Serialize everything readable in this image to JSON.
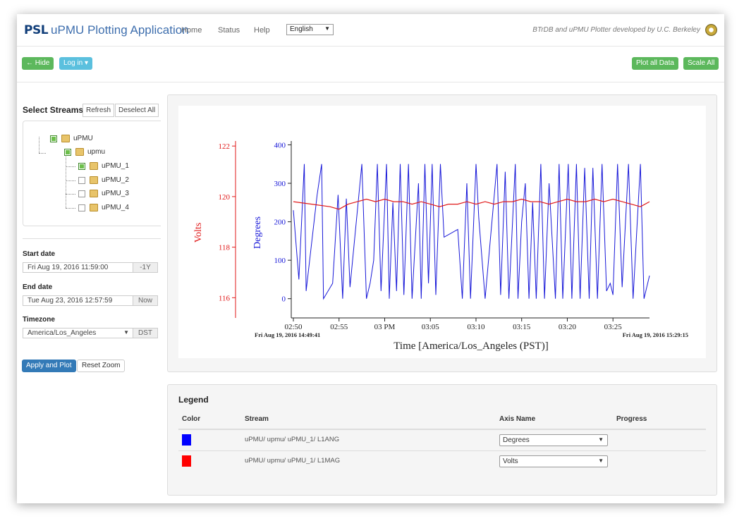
{
  "app": {
    "brand_abbrev": "PSL",
    "brand_title": "uPMU Plotting Application",
    "nav": [
      "Home",
      "Status",
      "Help"
    ],
    "language": "English",
    "credit": "BTrDB and uPMU Plotter developed by U.C. Berkeley"
  },
  "toolbar": {
    "hide_label": "← Hide",
    "login_label": "Log in ▾",
    "plot_all_label": "Plot all Data",
    "scale_all_label": "Scale All"
  },
  "sidebar": {
    "title": "Select Streams",
    "refresh_label": "Refresh",
    "deselect_label": "Deselect All",
    "tree": [
      {
        "label": "uPMU",
        "checked": true
      },
      {
        "label": "upmu",
        "checked": true
      },
      {
        "label": "uPMU_1",
        "checked": true
      },
      {
        "label": "uPMU_2",
        "checked": false
      },
      {
        "label": "uPMU_3",
        "checked": false
      },
      {
        "label": "uPMU_4",
        "checked": false
      }
    ],
    "start_label": "Start date",
    "start_value": "Fri Aug 19, 2016 11:59:00",
    "start_addon": "-1Y",
    "end_label": "End date",
    "end_value": "Tue Aug 23, 2016 12:57:59",
    "end_addon": "Now",
    "tz_label": "Timezone",
    "tz_value": "America/Los_Angeles",
    "tz_addon": "DST",
    "apply_label": "Apply and Plot",
    "reset_label": "Reset Zoom"
  },
  "chart_data": {
    "type": "line",
    "xlabel": "Time [America/Los_Angeles (PST)]",
    "start_stamp": "Fri Aug 19, 2016 14:49:41",
    "end_stamp": "Fri Aug 19, 2016 15:29:15",
    "x_ticks": [
      "02:50",
      "02:55",
      "03 PM",
      "03:05",
      "03:10",
      "03:15",
      "03:20",
      "03:25"
    ],
    "x_range_min": [
      50,
      89
    ],
    "y_axes": [
      {
        "name": "Volts",
        "color": "#e01818",
        "ylim": [
          115.2,
          122.2
        ],
        "ticks": [
          116,
          118,
          120,
          122
        ]
      },
      {
        "name": "Degrees",
        "color": "#1818d8",
        "ylim": [
          -50,
          410
        ],
        "ticks": [
          0,
          100,
          200,
          300,
          400
        ]
      }
    ],
    "series": [
      {
        "name": "Degrees",
        "axis": "Degrees",
        "color": "#1818d8",
        "points": [
          [
            50,
            230
          ],
          [
            50.6,
            50
          ],
          [
            51.2,
            350
          ],
          [
            51.4,
            20
          ],
          [
            52.6,
            270
          ],
          [
            53.1,
            350
          ],
          [
            53.3,
            0
          ],
          [
            54.3,
            40
          ],
          [
            54.9,
            270
          ],
          [
            55.4,
            0
          ],
          [
            55.8,
            260
          ],
          [
            56.2,
            30
          ],
          [
            57.5,
            350
          ],
          [
            58,
            0
          ],
          [
            58.4,
            40
          ],
          [
            58.8,
            100
          ],
          [
            59.2,
            350
          ],
          [
            59.6,
            20
          ],
          [
            60.2,
            350
          ],
          [
            60.5,
            0
          ],
          [
            60.9,
            250
          ],
          [
            61.3,
            20
          ],
          [
            61.7,
            350
          ],
          [
            62.1,
            10
          ],
          [
            62.6,
            350
          ],
          [
            63,
            0
          ],
          [
            63.7,
            300
          ],
          [
            64,
            0
          ],
          [
            64.4,
            350
          ],
          [
            64.8,
            40
          ],
          [
            65.2,
            350
          ],
          [
            65.6,
            10
          ],
          [
            66.1,
            350
          ],
          [
            66.5,
            160
          ],
          [
            68,
            180
          ],
          [
            68.5,
            0
          ],
          [
            69,
            300
          ],
          [
            69.4,
            0
          ],
          [
            70,
            350
          ],
          [
            70.3,
            210
          ],
          [
            71,
            0
          ],
          [
            72.3,
            350
          ],
          [
            72.7,
            10
          ],
          [
            73.2,
            330
          ],
          [
            73.6,
            0
          ],
          [
            74.3,
            350
          ],
          [
            74.6,
            0
          ],
          [
            75,
            200
          ],
          [
            75.4,
            300
          ],
          [
            75.8,
            0
          ],
          [
            76.2,
            250
          ],
          [
            76.6,
            0
          ],
          [
            77.1,
            350
          ],
          [
            77.5,
            0
          ],
          [
            78,
            300
          ],
          [
            78.7,
            0
          ],
          [
            79.1,
            350
          ],
          [
            79.5,
            0
          ],
          [
            80.1,
            350
          ],
          [
            80.5,
            0
          ],
          [
            81,
            350
          ],
          [
            81.4,
            0
          ],
          [
            81.9,
            340
          ],
          [
            82.4,
            0
          ],
          [
            82.8,
            340
          ],
          [
            83.3,
            0
          ],
          [
            83.8,
            350
          ],
          [
            84.3,
            20
          ],
          [
            84.7,
            40
          ],
          [
            85,
            10
          ],
          [
            85.5,
            350
          ],
          [
            86,
            30
          ],
          [
            86.7,
            350
          ],
          [
            87.2,
            0
          ],
          [
            88,
            350
          ],
          [
            88.4,
            0
          ],
          [
            89,
            60
          ]
        ]
      },
      {
        "name": "Volts",
        "axis": "Volts",
        "color": "#e01818",
        "points": [
          [
            50,
            119.8
          ],
          [
            52,
            119.7
          ],
          [
            54,
            119.6
          ],
          [
            55,
            119.5
          ],
          [
            56,
            119.7
          ],
          [
            57,
            119.8
          ],
          [
            58,
            119.9
          ],
          [
            59,
            119.8
          ],
          [
            60,
            119.9
          ],
          [
            61,
            119.8
          ],
          [
            62,
            119.8
          ],
          [
            63,
            119.7
          ],
          [
            64,
            119.8
          ],
          [
            65,
            119.7
          ],
          [
            66,
            119.6
          ],
          [
            67,
            119.7
          ],
          [
            68,
            119.7
          ],
          [
            69,
            119.8
          ],
          [
            70,
            119.7
          ],
          [
            71,
            119.8
          ],
          [
            72,
            119.7
          ],
          [
            73,
            119.8
          ],
          [
            74,
            119.8
          ],
          [
            75,
            119.9
          ],
          [
            76,
            119.8
          ],
          [
            77,
            119.8
          ],
          [
            78,
            119.7
          ],
          [
            79,
            119.8
          ],
          [
            80,
            119.9
          ],
          [
            81,
            119.8
          ],
          [
            82,
            119.8
          ],
          [
            83,
            119.9
          ],
          [
            84,
            119.8
          ],
          [
            85,
            119.9
          ],
          [
            86,
            119.8
          ],
          [
            87,
            119.7
          ],
          [
            88,
            119.6
          ],
          [
            89,
            119.8
          ]
        ]
      }
    ]
  },
  "legend": {
    "title": "Legend",
    "headers": {
      "color": "Color",
      "stream": "Stream",
      "axis": "Axis Name",
      "progress": "Progress"
    },
    "rows": [
      {
        "color": "#0000ff",
        "stream": "uPMU/ upmu/ uPMU_1/ L1ANG",
        "axis": "Degrees"
      },
      {
        "color": "#ff0000",
        "stream": "uPMU/ upmu/ uPMU_1/ L1MAG",
        "axis": "Volts"
      }
    ]
  }
}
